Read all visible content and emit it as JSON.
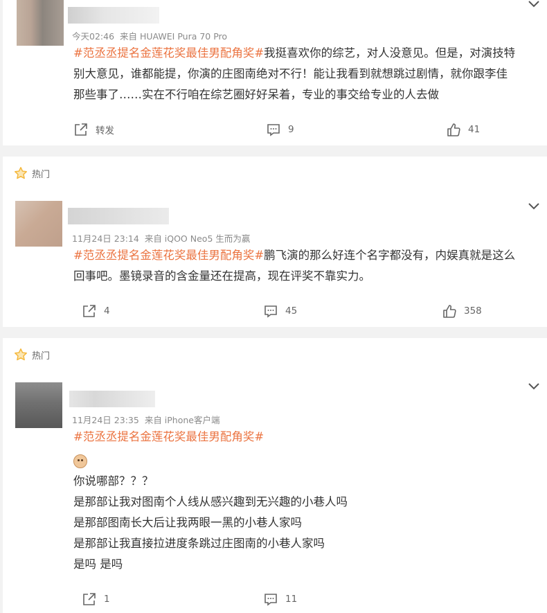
{
  "comments": [
    {
      "meta": {
        "time": "今天02:46",
        "source": "来自 HUAWEI Pura 70 Pro"
      },
      "topic": "#范丞丞提名金莲花奖最佳男配角奖#",
      "lines": [
        "我挺喜欢你的综艺，对人没意见。但是，对演技特",
        "别大意见，谁都能提，你演的庄图南绝对不行！能让我看到就想跳过剧情，就你跟李佳",
        "那些事了……实在不行咱在综艺圈好好呆着，专业的事交给专业的人去做"
      ],
      "actions": {
        "repost": "转发",
        "comment": "9",
        "like": "41"
      }
    },
    {
      "hot": "热门",
      "meta": {
        "time": "11月24日 23:14",
        "source": "来自 iQOO Neo5 生而为赢"
      },
      "topic": "#范丞丞提名金莲花奖最佳男配角奖#",
      "lines": [
        "鹏飞演的那么好连个名字都没有，内娱真就是这么",
        "回事吧。墨镜录音的含金量还在提高，现在评奖不靠实力。"
      ],
      "actions": {
        "repost": "4",
        "comment": "45",
        "like": "358"
      }
    },
    {
      "hot": "热门",
      "meta": {
        "time": "11月24日 23:35",
        "source": "来自 iPhone客户端"
      },
      "topic": "#范丞丞提名金莲花奖最佳男配角奖#",
      "lines": [
        "你说哪部？？？",
        "是那部让我对图南个人线从感兴趣到无兴趣的小巷人吗",
        "是那部图南长大后让我两眼一黑的小巷人家吗",
        "是那部让我直接拉进度条跳过庄图南的小巷人家吗",
        "是吗 是吗"
      ],
      "actions": {
        "repost": "1",
        "comment": "11"
      }
    }
  ],
  "colors": {
    "topic": "#eb7340",
    "hot_star": "#f5b83d"
  }
}
